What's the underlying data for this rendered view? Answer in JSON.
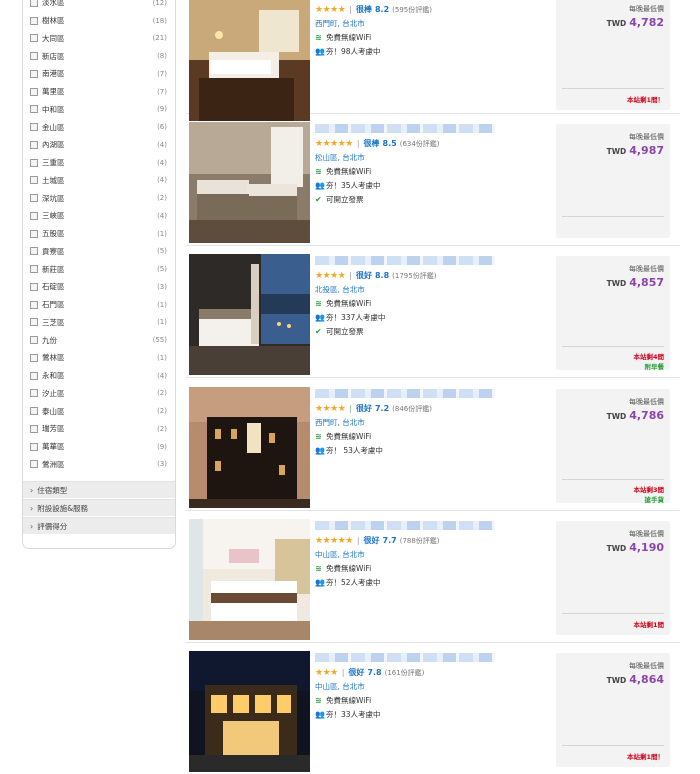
{
  "sidebar": {
    "districts": [
      {
        "name": "淡水區",
        "count": "(12)"
      },
      {
        "name": "樹林區",
        "count": "(18)"
      },
      {
        "name": "大同區",
        "count": "(21)"
      },
      {
        "name": "新店區",
        "count": "(8)"
      },
      {
        "name": "南港區",
        "count": "(7)"
      },
      {
        "name": "萬里區",
        "count": "(7)"
      },
      {
        "name": "中和區",
        "count": "(9)"
      },
      {
        "name": "金山區",
        "count": "(6)"
      },
      {
        "name": "內湖區",
        "count": "(4)"
      },
      {
        "name": "三重區",
        "count": "(4)"
      },
      {
        "name": "土城區",
        "count": "(4)"
      },
      {
        "name": "深坑區",
        "count": "(2)"
      },
      {
        "name": "三峽區",
        "count": "(4)"
      },
      {
        "name": "五股區",
        "count": "(1)"
      },
      {
        "name": "貢寮區",
        "count": "(5)"
      },
      {
        "name": "新莊區",
        "count": "(5)"
      },
      {
        "name": "石碇區",
        "count": "(3)"
      },
      {
        "name": "石門區",
        "count": "(1)"
      },
      {
        "name": "三芝區",
        "count": "(1)"
      },
      {
        "name": "九份",
        "count": "(55)"
      },
      {
        "name": "鶯林區",
        "count": "(1)"
      },
      {
        "name": "永和區",
        "count": "(4)"
      },
      {
        "name": "汐止區",
        "count": "(2)"
      },
      {
        "name": "泰山區",
        "count": "(2)"
      },
      {
        "name": "瑞芳區",
        "count": "(2)"
      },
      {
        "name": "萬華區",
        "count": "(9)"
      },
      {
        "name": "鶯洲區",
        "count": "(3)"
      }
    ],
    "filters": [
      {
        "label": "住宿類型"
      },
      {
        "label": "附設設施&服務"
      },
      {
        "label": "評價得分"
      }
    ]
  },
  "hotels": [
    {
      "name": "",
      "stars": "★★★★",
      "verdict": "很棒",
      "score": "8.2",
      "reviews": "(595份評鑑)",
      "location": "西門町, 台北市",
      "features": [
        {
          "icon": "wifi-icon",
          "glyph": "≋",
          "text": "免費無線WiFi"
        },
        {
          "icon": "people-icon",
          "glyph": "👥",
          "text": "夯！98人考慮中"
        }
      ],
      "per_night": "每晚最低價",
      "currency": "TWD",
      "price": "4,782",
      "last_room": "本站剩1間！",
      "tag": ""
    },
    {
      "name": "",
      "stars": "★★★★★",
      "verdict": "很棒",
      "score": "8.5",
      "reviews": "(634份評鑑)",
      "location": "松山區, 台北市",
      "features": [
        {
          "icon": "wifi-icon",
          "glyph": "≋",
          "text": "免費無線WiFi"
        },
        {
          "icon": "people-icon",
          "glyph": "👥",
          "text": "夯！35人考慮中"
        },
        {
          "icon": "check-icon",
          "glyph": "✔",
          "text": "可開立發票"
        }
      ],
      "per_night": "每晚最低價",
      "currency": "TWD",
      "price": "4,987",
      "last_room": "",
      "tag": ""
    },
    {
      "name": "",
      "stars": "★★★★",
      "verdict": "很好",
      "score": "8.8",
      "reviews": "(1795份評鑑)",
      "location": "北投區, 台北市",
      "features": [
        {
          "icon": "wifi-icon",
          "glyph": "≋",
          "text": "免費無線WiFi"
        },
        {
          "icon": "people-icon",
          "glyph": "👥",
          "text": "夯！337人考慮中"
        },
        {
          "icon": "check-icon",
          "glyph": "✔",
          "text": "可開立發票"
        }
      ],
      "per_night": "每晚最低價",
      "currency": "TWD",
      "price": "4,857",
      "last_room": "本站剩4間",
      "tag": "附早餐"
    },
    {
      "name": "",
      "stars": "★★★★",
      "verdict": "很好",
      "score": "7.2",
      "reviews": "(846份評鑑)",
      "location": "西門町, 台北市",
      "features": [
        {
          "icon": "wifi-icon",
          "glyph": "≋",
          "text": "免費無線WiFi"
        },
        {
          "icon": "people-icon",
          "glyph": "👥",
          "text": "夯！ 53人考慮中"
        }
      ],
      "per_night": "每晚最低價",
      "currency": "TWD",
      "price": "4,786",
      "last_room": "本站剩3間",
      "tag": "搶手貨"
    },
    {
      "name": "",
      "stars": "★★★★★",
      "verdict": "很好",
      "score": "7.7",
      "reviews": "(788份評鑑)",
      "location": "中山區, 台北市",
      "features": [
        {
          "icon": "wifi-icon",
          "glyph": "≋",
          "text": "免費無線WiFi"
        },
        {
          "icon": "people-icon",
          "glyph": "👥",
          "text": "夯！52人考慮中"
        }
      ],
      "per_night": "每晚最低價",
      "currency": "TWD",
      "price": "4,190",
      "last_room": "本站剩1間",
      "tag": ""
    },
    {
      "name": "",
      "stars": "★★★",
      "verdict": "很好",
      "score": "7.8",
      "reviews": "(161份評鑑)",
      "location": "中山區, 台北市",
      "features": [
        {
          "icon": "wifi-icon",
          "glyph": "≋",
          "text": "免費無線WiFi"
        },
        {
          "icon": "people-icon",
          "glyph": "👥",
          "text": "夯！33人考慮中"
        }
      ],
      "per_night": "每晚最低價",
      "currency": "TWD",
      "price": "4,864",
      "last_room": "本站剩1間！",
      "tag": ""
    }
  ],
  "colors": {
    "link_blue": "#1a73c8",
    "price_purple": "#8e44ad",
    "alert_red": "#d0021b",
    "ok_green": "#2a9d3a",
    "star_orange": "#f5a623"
  }
}
